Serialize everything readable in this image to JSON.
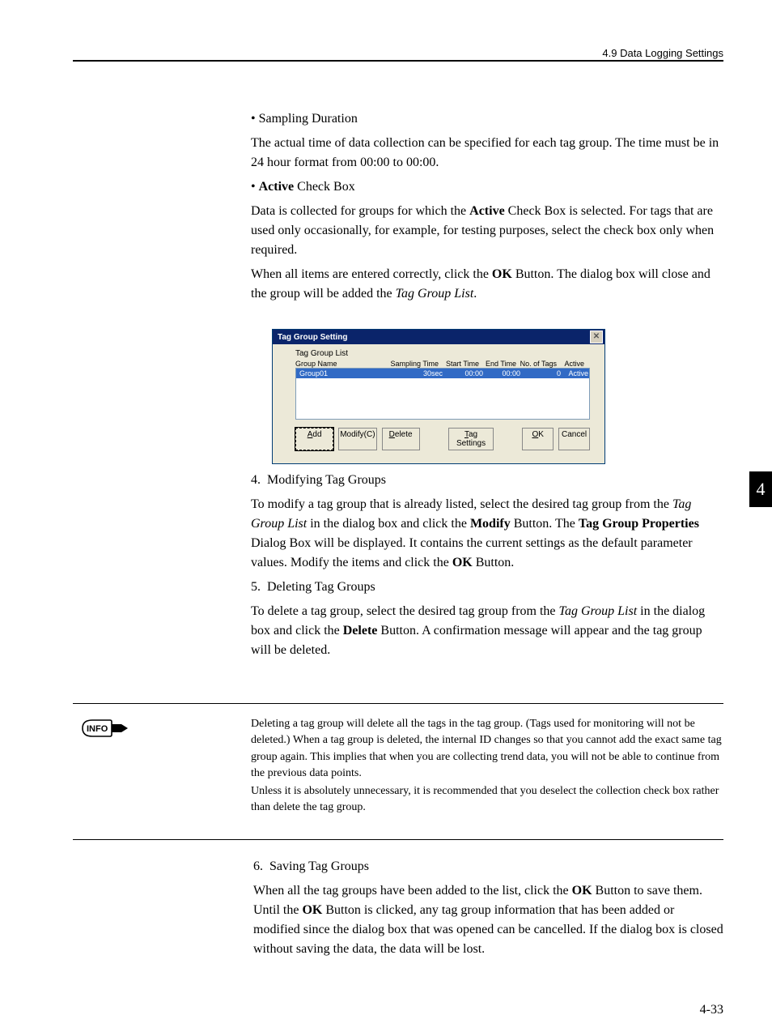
{
  "header": {
    "breadcrumb": "4.9  Data Logging Settings"
  },
  "tab": {
    "number": "4"
  },
  "body": {
    "sampling_duration_label": "Sampling Duration",
    "sampling_duration_text": "The actual time of data collection can be specified for each tag group. The time must be in 24 hour format from 00:00 to 00:00.",
    "active_bold": "Active",
    "active_rest": " Check Box",
    "active_text_1": "Data is collected for groups for which the ",
    "active_text_2": " Check Box is selected. For tags that are used only occasionally, for example, for testing purposes, select the check box only when required.",
    "ok_para_1": "When all items are entered correctly, click the ",
    "ok_bold": "OK",
    "ok_para_2": " Button. The dialog box will close and the group will be added the ",
    "ok_italic": "Tag Group List",
    "ok_para_3": ".",
    "item4_num": "4.",
    "item4_title": "Modifying Tag Groups",
    "item4_p1a": "To modify a tag group that is already listed, select the desired tag group from the ",
    "item4_i1": "Tag Group List",
    "item4_p1b": " in the dialog box and click the ",
    "item4_b1": "Modify",
    "item4_p1c": " Button. The ",
    "item4_b2": "Tag Group Properties",
    "item4_p1d": " Dialog Box will be displayed. It contains the current settings as the default parameter values. Modify the items and click the ",
    "item4_b3": "OK",
    "item4_p1e": " Button.",
    "item5_num": "5.",
    "item5_title": "Deleting Tag Groups",
    "item5_p1a": "To delete a tag group, select the desired tag group from the ",
    "item5_i1": "Tag Group List",
    "item5_p1b": " in the dialog box and click the ",
    "item5_b1": "Delete",
    "item5_p1c": " Button. A confirmation message will appear and the tag group will be deleted.",
    "item6_num": "6.",
    "item6_title": "Saving Tag Groups",
    "item6_p1a": "When all the tag groups have been added to the list, click the ",
    "item6_b1": "OK",
    "item6_p1b": " Button to save them. Until the ",
    "item6_b2": "OK",
    "item6_p1c": " Button is clicked, any tag group information that has been added or modified since the dialog box that was opened can be cancelled. If the dialog box is closed without saving the data, the data will be lost."
  },
  "info": {
    "label": "INFO",
    "p1": "Deleting a tag group will delete all the tags in the tag group. (Tags used for monitoring will not be deleted.) When a tag group is deleted, the internal ID changes so that you cannot add the exact same tag group again. This implies that when you are collecting trend data, you will not be able to continue from the previous data points.",
    "p2": "Unless it is absolutely unnecessary, it is recommended that you deselect the collection check box rather than delete the tag group."
  },
  "dialog": {
    "title": "Tag Group Setting",
    "list_label": "Tag Group List",
    "cols": {
      "name": "Group Name",
      "samp": "Sampling Time",
      "start": "Start Time",
      "end": "End Time",
      "tags": "No. of Tags",
      "active": "Active"
    },
    "row": {
      "name": "Group01",
      "samp": "30sec",
      "start": "00:00",
      "end": "00:00",
      "tags": "0",
      "active": "Active"
    },
    "buttons": {
      "add": "Add",
      "modify": "Modify(C)",
      "delete": "Delete",
      "tagset": "Tag Settings",
      "ok": "OK",
      "cancel": "Cancel"
    }
  },
  "page_number": "4-33"
}
